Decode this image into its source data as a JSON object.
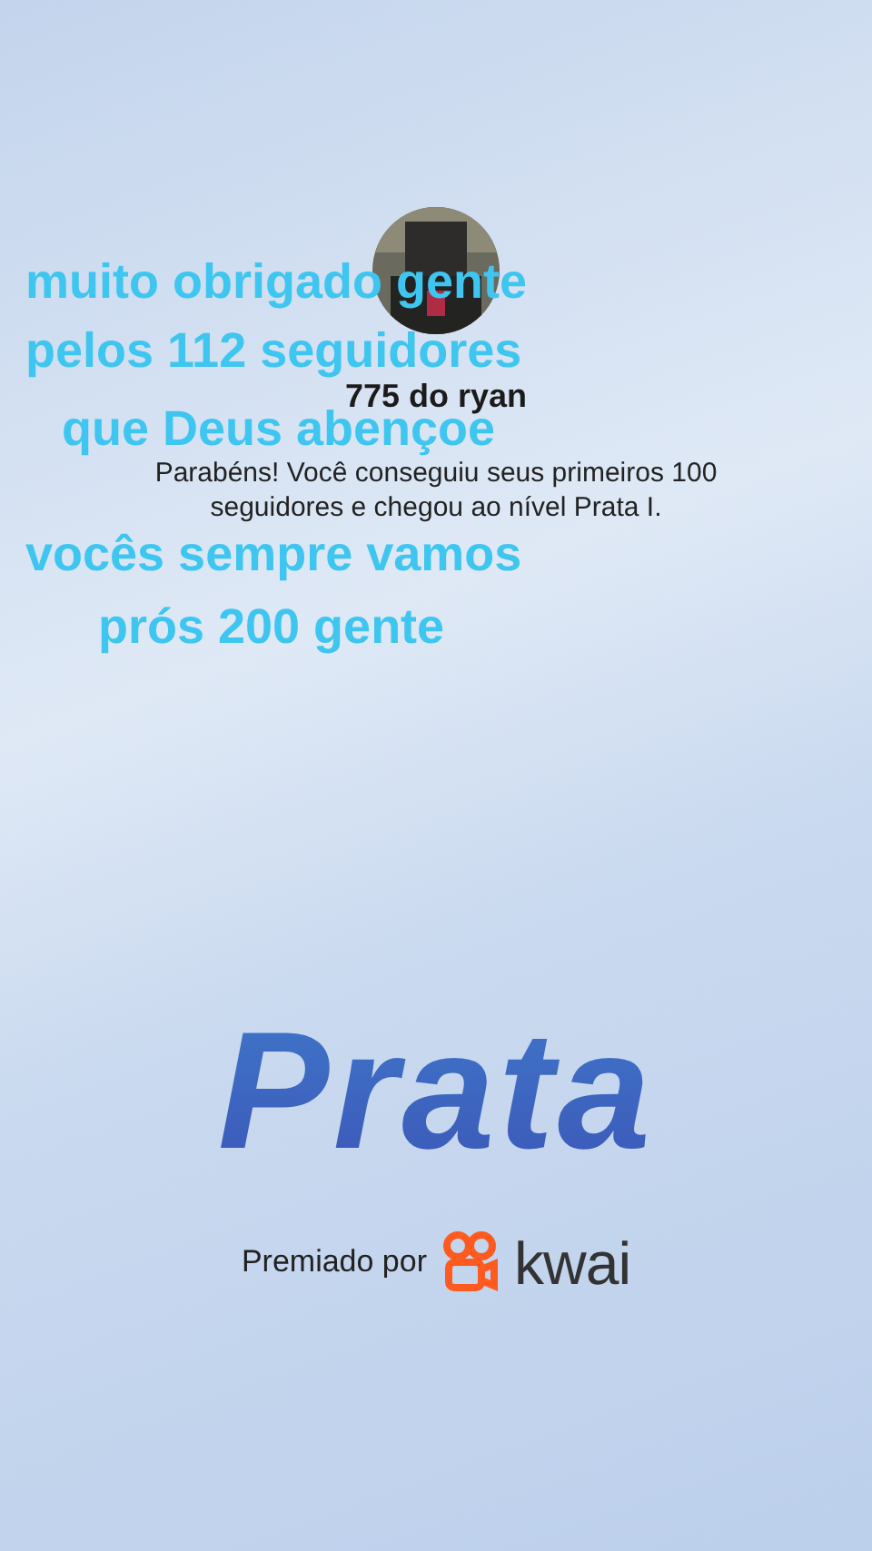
{
  "profile": {
    "name": "775 do ryan",
    "message": "Parabéns! Você conseguiu seus primeiros 100 seguidores e chegou ao nível Prata I."
  },
  "caption_lines": [
    "muito obrigado gente",
    "pelos 112 seguidores",
    "que Deus abençoe",
    "vocês sempre vamos",
    "prós 200 gente"
  ],
  "level": {
    "title": "Prata"
  },
  "award": {
    "label": "Premiado por",
    "brand": "kwai"
  }
}
